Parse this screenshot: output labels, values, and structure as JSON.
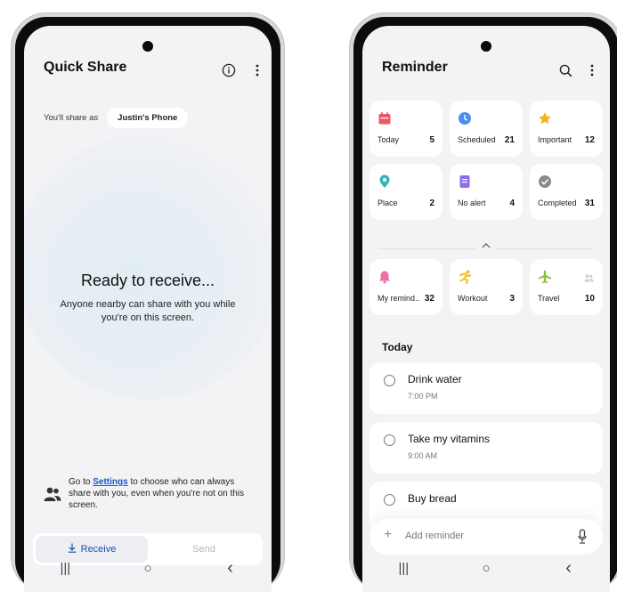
{
  "quick_share": {
    "title": "Quick Share",
    "share_as_label": "You'll share as",
    "device_name": "Justin's Phone",
    "heading": "Ready to receive...",
    "subtext": "Anyone nearby can share with you while you're on this screen.",
    "note_prefix": "Go to ",
    "note_link": "Settings",
    "note_suffix": " to choose who can always share with you, even when you're not on this screen.",
    "tabs": [
      {
        "label": "Receive",
        "icon": "download-icon",
        "active": true
      },
      {
        "label": "Send",
        "active": false
      }
    ],
    "icons": [
      "info-icon",
      "more-vert-icon",
      "people-icon"
    ]
  },
  "reminder": {
    "title": "Reminder",
    "categories": [
      {
        "label": "Today",
        "count": "5",
        "icon": "calendar-icon",
        "color": "#f0566a"
      },
      {
        "label": "Scheduled",
        "count": "21",
        "icon": "clock-icon",
        "color": "#4b8ff0"
      },
      {
        "label": "Important",
        "count": "12",
        "icon": "star-icon",
        "color": "#f5b416"
      },
      {
        "label": "Place",
        "count": "2",
        "icon": "location-icon",
        "color": "#34b3b8"
      },
      {
        "label": "No alert",
        "count": "4",
        "icon": "note-icon",
        "color": "#8c6ee6"
      },
      {
        "label": "Completed",
        "count": "31",
        "icon": "check-icon",
        "color": "#8a8a8e"
      }
    ],
    "custom_categories": [
      {
        "label": "My remind..",
        "count": "32",
        "icon": "bell-icon",
        "color": "#ee6fa8"
      },
      {
        "label": "Workout",
        "count": "3",
        "icon": "run-icon",
        "color": "#f2c22a"
      },
      {
        "label": "Travel",
        "count": "10",
        "icon": "plane-icon",
        "color": "#86c23e"
      }
    ],
    "section_title": "Today",
    "tasks": [
      {
        "name": "Drink water",
        "time": "7:00 PM"
      },
      {
        "name": "Take my vitamins",
        "time": "9:00 AM"
      },
      {
        "name": "Buy bread",
        "time": ""
      }
    ],
    "add_placeholder": "Add reminder",
    "icons": [
      "search-icon",
      "more-vert-icon",
      "mic-icon",
      "chevron-up-icon"
    ]
  },
  "nav": {
    "recents": "|||",
    "home": "○",
    "back": "‹"
  }
}
